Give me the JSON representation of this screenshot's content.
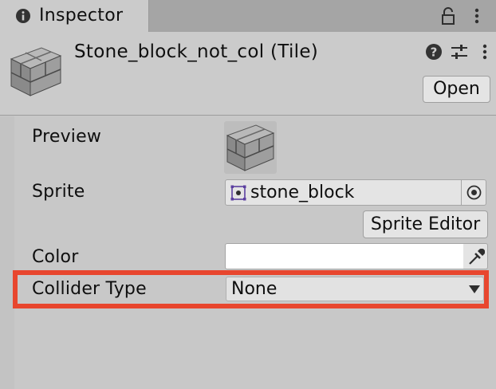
{
  "tab": {
    "title": "Inspector",
    "icon": "info-icon"
  },
  "header": {
    "asset_title": "Stone_block_not_col (Tile)",
    "open_label": "Open"
  },
  "properties": {
    "preview_label": "Preview",
    "sprite_label": "Sprite",
    "sprite_value": "stone_block",
    "sprite_editor_label": "Sprite Editor",
    "color_label": "Color",
    "color_value": "#ffffff",
    "collider_type_label": "Collider Type",
    "collider_type_value": "None"
  },
  "colors": {
    "highlight": "#e8462e",
    "panel_bg": "#c8c8c8",
    "tabbar_bg": "#a5a5a5",
    "field_bg": "#e4e4e4"
  }
}
